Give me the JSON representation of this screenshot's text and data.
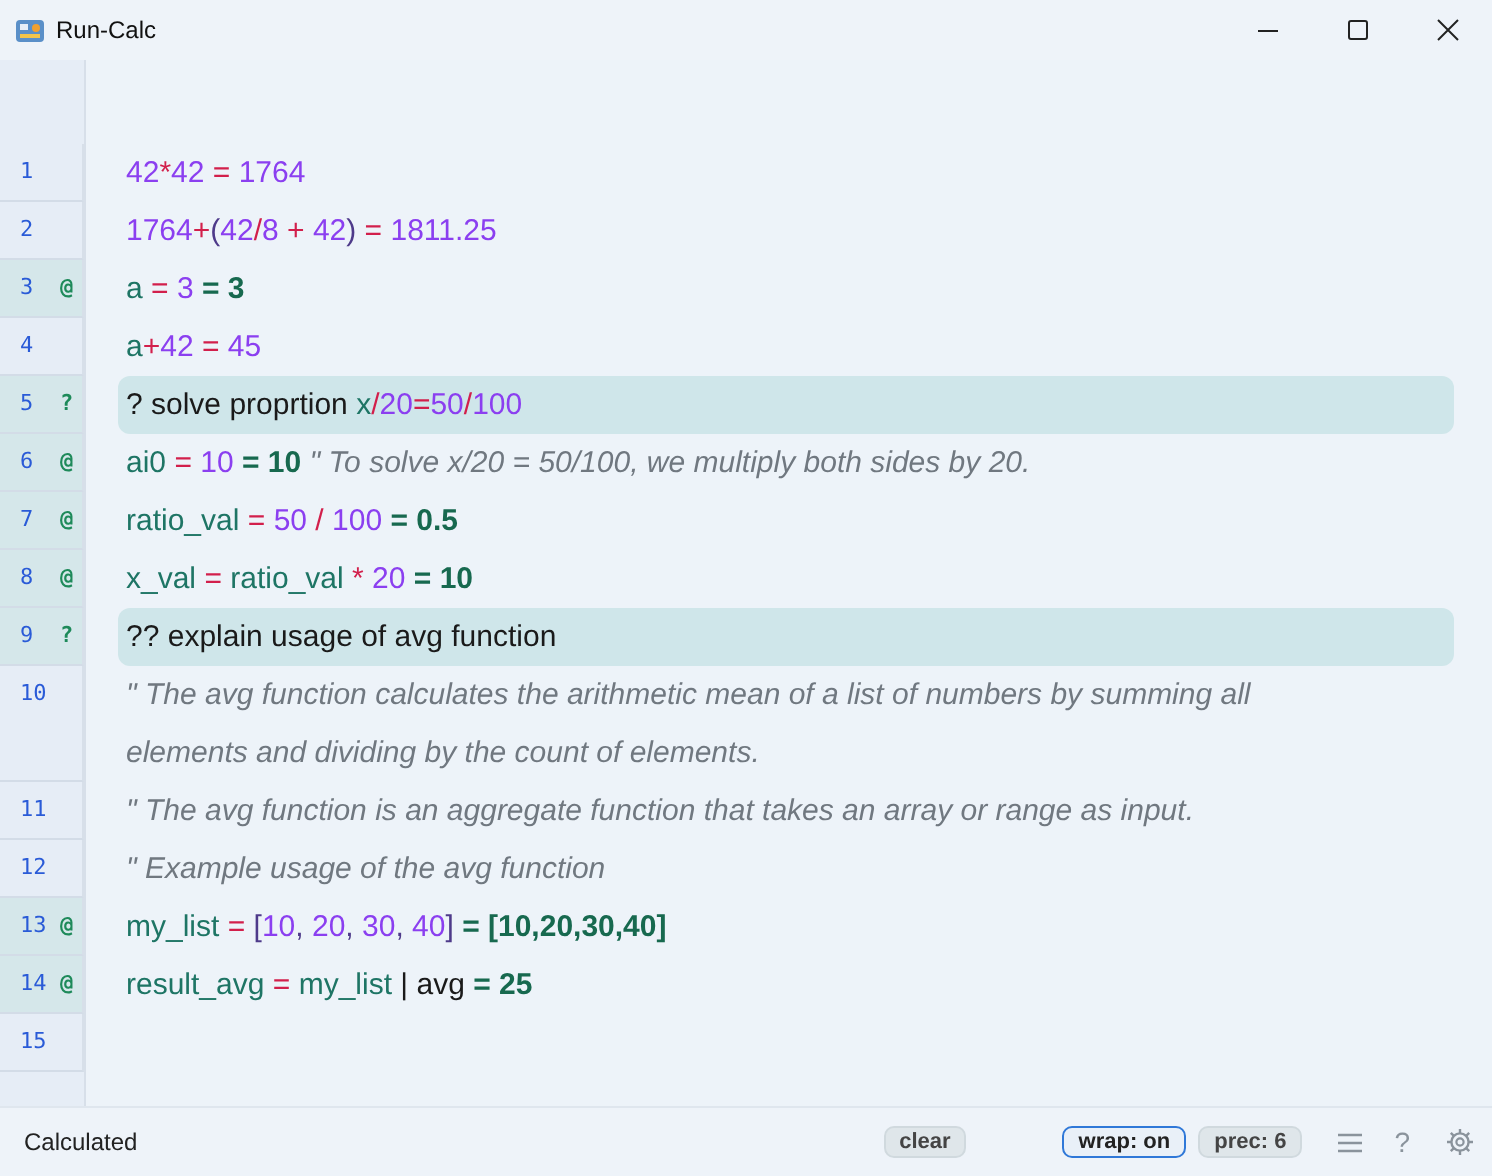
{
  "window": {
    "title": "Run-Calc"
  },
  "lines": [
    {
      "number": "1",
      "kind": "calc",
      "tokens": [
        {
          "text": "42",
          "kind": "num"
        },
        {
          "text": "*",
          "kind": "op"
        },
        {
          "text": "42",
          "kind": "num"
        },
        {
          "text": " = ",
          "kind": "op"
        },
        {
          "text": "1764",
          "kind": "num"
        }
      ]
    },
    {
      "number": "2",
      "kind": "calc",
      "tokens": [
        {
          "text": "1764",
          "kind": "num"
        },
        {
          "text": "+",
          "kind": "op"
        },
        {
          "text": "(",
          "kind": "paren"
        },
        {
          "text": "42",
          "kind": "num"
        },
        {
          "text": "/",
          "kind": "op"
        },
        {
          "text": "8",
          "kind": "num"
        },
        {
          "text": " + ",
          "kind": "op"
        },
        {
          "text": "42",
          "kind": "num"
        },
        {
          "text": ")",
          "kind": "paren"
        },
        {
          "text": " = ",
          "kind": "op"
        },
        {
          "text": "1811.25",
          "kind": "num"
        }
      ]
    },
    {
      "number": "3",
      "marker": "@",
      "kind": "calc",
      "tokens": [
        {
          "text": "a",
          "kind": "var"
        },
        {
          "text": " = ",
          "kind": "op"
        },
        {
          "text": "3",
          "kind": "num"
        },
        {
          "text": " = 3",
          "kind": "result"
        }
      ]
    },
    {
      "number": "4",
      "kind": "calc",
      "tokens": [
        {
          "text": "a",
          "kind": "var"
        },
        {
          "text": "+",
          "kind": "op"
        },
        {
          "text": "42",
          "kind": "num"
        },
        {
          "text": " = ",
          "kind": "op"
        },
        {
          "text": "45",
          "kind": "num"
        }
      ]
    },
    {
      "number": "5",
      "marker": "?",
      "kind": "question",
      "tokens": [
        {
          "text": "? solve proprtion ",
          "kind": "plain"
        },
        {
          "text": "x",
          "kind": "var"
        },
        {
          "text": "/",
          "kind": "op"
        },
        {
          "text": "20",
          "kind": "num"
        },
        {
          "text": "=",
          "kind": "op"
        },
        {
          "text": "50",
          "kind": "num"
        },
        {
          "text": "/",
          "kind": "op"
        },
        {
          "text": "100",
          "kind": "num"
        }
      ]
    },
    {
      "number": "6",
      "marker": "@",
      "kind": "calc",
      "tokens": [
        {
          "text": "ai0",
          "kind": "var"
        },
        {
          "text": " = ",
          "kind": "op"
        },
        {
          "text": "10",
          "kind": "num"
        },
        {
          "text": " = 10",
          "kind": "result"
        },
        {
          "text": " \" To solve x/20 = 50/100, we multiply both sides by 20.",
          "kind": "comment"
        }
      ]
    },
    {
      "number": "7",
      "marker": "@",
      "kind": "calc",
      "tokens": [
        {
          "text": "ratio_val",
          "kind": "var"
        },
        {
          "text": " = ",
          "kind": "op"
        },
        {
          "text": "50",
          "kind": "num"
        },
        {
          "text": " / ",
          "kind": "op"
        },
        {
          "text": "100",
          "kind": "num"
        },
        {
          "text": " = 0.5",
          "kind": "result"
        }
      ]
    },
    {
      "number": "8",
      "marker": "@",
      "kind": "calc",
      "tokens": [
        {
          "text": "x_val",
          "kind": "var"
        },
        {
          "text": " = ",
          "kind": "op"
        },
        {
          "text": "ratio_val",
          "kind": "var"
        },
        {
          "text": " * ",
          "kind": "op"
        },
        {
          "text": "20",
          "kind": "num"
        },
        {
          "text": " = 10",
          "kind": "result"
        }
      ]
    },
    {
      "number": "9",
      "marker": "?",
      "kind": "question",
      "tokens": [
        {
          "text": "?? explain usage of avg function",
          "kind": "plain"
        }
      ]
    },
    {
      "number": "10",
      "kind": "calc",
      "tokens": [
        {
          "text": "\" The avg function calculates the arithmetic mean of a list of numbers by summing all elements and dividing by the count of elements.",
          "kind": "comment"
        }
      ]
    },
    {
      "number": "11",
      "kind": "calc",
      "tokens": [
        {
          "text": "\" The avg function is an aggregate function that takes an array or range as input.",
          "kind": "comment"
        }
      ]
    },
    {
      "number": "12",
      "kind": "calc",
      "tokens": [
        {
          "text": "\" Example usage of the avg function",
          "kind": "comment"
        }
      ]
    },
    {
      "number": "13",
      "marker": "@",
      "kind": "calc",
      "tokens": [
        {
          "text": "my_list",
          "kind": "var"
        },
        {
          "text": " = ",
          "kind": "op"
        },
        {
          "text": "[",
          "kind": "paren"
        },
        {
          "text": "10",
          "kind": "num"
        },
        {
          "text": ", ",
          "kind": "paren"
        },
        {
          "text": "20",
          "kind": "num"
        },
        {
          "text": ", ",
          "kind": "paren"
        },
        {
          "text": "30",
          "kind": "num"
        },
        {
          "text": ", ",
          "kind": "paren"
        },
        {
          "text": "40",
          "kind": "num"
        },
        {
          "text": "]",
          "kind": "paren"
        },
        {
          "text": " = [10,20,30,40]",
          "kind": "result"
        }
      ]
    },
    {
      "number": "14",
      "marker": "@",
      "kind": "calc",
      "tokens": [
        {
          "text": "result_avg",
          "kind": "var"
        },
        {
          "text": " = ",
          "kind": "op"
        },
        {
          "text": "my_list",
          "kind": "var"
        },
        {
          "text": " | avg",
          "kind": "plain"
        },
        {
          "text": " = 25",
          "kind": "result"
        }
      ]
    },
    {
      "number": "15",
      "kind": "calc"
    }
  ],
  "status_bar": {
    "status": "Calculated",
    "buttons": [
      {
        "label": "clear",
        "selected": false
      },
      {
        "label": "wrap: on",
        "selected": true
      },
      {
        "label": "prec: 6",
        "selected": false
      }
    ],
    "help": "?"
  }
}
